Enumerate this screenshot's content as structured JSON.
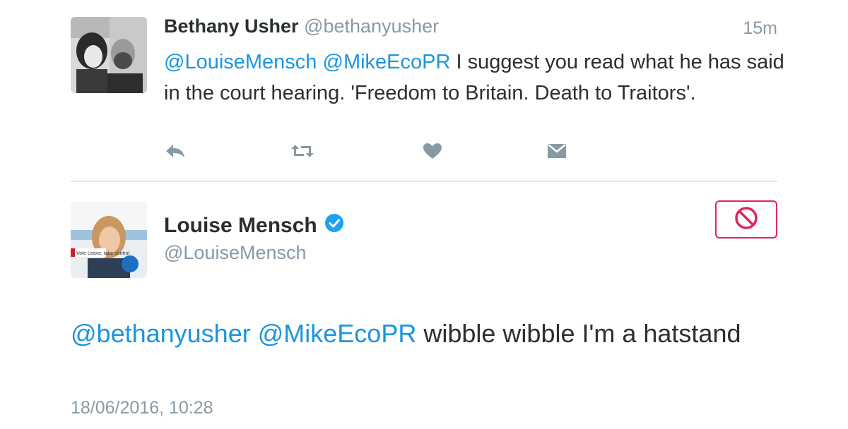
{
  "tweet1": {
    "name": "Bethany Usher",
    "handle": "@bethanyusher",
    "time": "15m",
    "mention1": "@LouiseMensch",
    "mention2": "@MikeEcoPR",
    "body": "I suggest you read what he has said in the court hearing. 'Freedom to Britain. Death to Traitors'.",
    "actions": [
      "reply-icon",
      "retweet-icon",
      "like-icon",
      "direct-message-icon"
    ]
  },
  "tweet2": {
    "name": "Louise Mensch",
    "handle": "@LouiseMensch",
    "avatar_caption": "Vote Leave, take control",
    "mention1": "@bethanyusher",
    "mention2": "@MikeEcoPR",
    "body": "wibble wibble I'm a hatstand",
    "date": "18/06/2016, 10:28",
    "verified": true
  },
  "colors": {
    "link": "#1b95e0",
    "muted": "#8899a6",
    "block": "#e0245e",
    "verified": "#1da1f2"
  }
}
